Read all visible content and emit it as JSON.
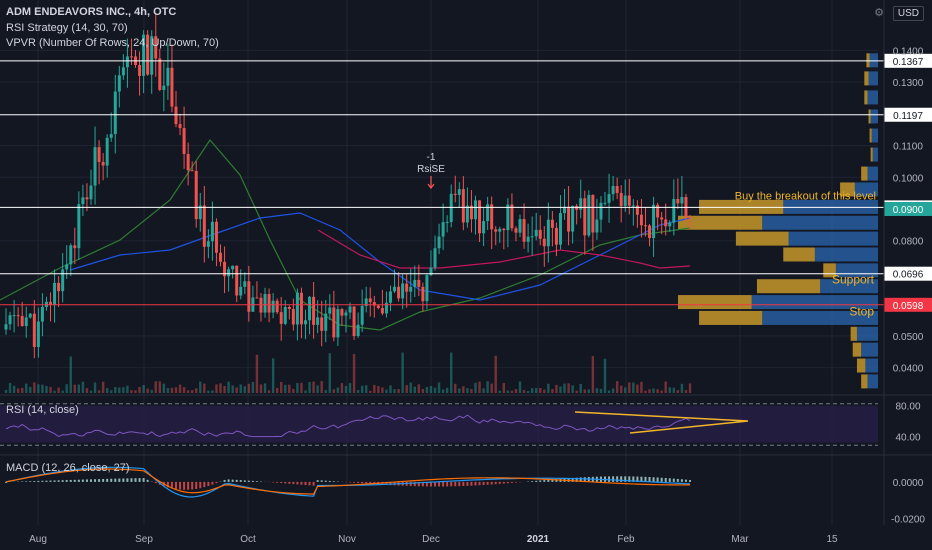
{
  "header": {
    "title": "ADM ENDEAVORS INC., 4h, OTC",
    "ind1": "RSI Strategy (14, 30, 70)",
    "ind2": "VPVR (Number Of Rows, 24, Up/Down, 70)",
    "rsi_label": "RSI (14, close)",
    "macd_label": "MACD (12, 26, close, 27)",
    "currency": "USD"
  },
  "colors": {
    "bg": "#131722",
    "grid": "#1f2433",
    "up": "#26a69a",
    "down": "#ef5350",
    "vpvr_up": "#2962a8",
    "vpvr_down": "#c7962a",
    "support_red": "#f23645",
    "ma_red": "#c2185b",
    "ma_green": "#2e7d32",
    "ma_blue": "#1e53e5",
    "annot": "#f0b429",
    "rsi_bg": "#2a1f4a"
  },
  "chart_data": {
    "type": "candlestick",
    "x_ticks": [
      "Aug",
      "Sep",
      "Oct",
      "Nov",
      "Dec",
      "2021",
      "Feb",
      "Mar",
      "15"
    ],
    "y_ticks": [
      "0.1400",
      "0.1300",
      "0.1100",
      "0.1000",
      "0.0800",
      "0.0500",
      "0.0400"
    ],
    "ylim": [
      0.032,
      0.142
    ],
    "price_levels": [
      {
        "value": 0.1367,
        "label": "0.1367",
        "color": "#ffffff"
      },
      {
        "value": 0.1197,
        "label": "0.1197",
        "color": "#ffffff"
      },
      {
        "value": 0.0905,
        "label": "0.0905",
        "color": "#ffffff"
      },
      {
        "value": 0.0696,
        "label": "0.0696",
        "color": "#ffffff"
      },
      {
        "value": 0.0598,
        "label": "0.0598",
        "color": "#f23645"
      }
    ],
    "last_price": {
      "value": 0.09,
      "label": "0.0900"
    },
    "annotations": [
      {
        "text": "Buy the breakout of this level",
        "y": 0.093
      },
      {
        "text": "Support",
        "y": 0.0665
      },
      {
        "text": "Stop",
        "y": 0.0565
      }
    ],
    "signal": {
      "top": "-1",
      "bottom": "RsiSE"
    },
    "trend": [
      0.052,
      0.058,
      0.05,
      0.062,
      0.075,
      0.09,
      0.105,
      0.12,
      0.133,
      0.138,
      0.136,
      0.128,
      0.1,
      0.082,
      0.078,
      0.07,
      0.062,
      0.058,
      0.056,
      0.058,
      0.06,
      0.056,
      0.054,
      0.055,
      0.057,
      0.06,
      0.062,
      0.064,
      0.067,
      0.09,
      0.09,
      0.088,
      0.086,
      0.085,
      0.085,
      0.083,
      0.084,
      0.085,
      0.088,
      0.09,
      0.092,
      0.089,
      0.087,
      0.087,
      0.088,
      0.089
    ],
    "vpvr": [
      {
        "price": 0.1367,
        "up": 8,
        "down": 3
      },
      {
        "price": 0.131,
        "up": 9,
        "down": 4
      },
      {
        "price": 0.125,
        "up": 10,
        "down": 3
      },
      {
        "price": 0.119,
        "up": 7,
        "down": 2
      },
      {
        "price": 0.113,
        "up": 6,
        "down": 2
      },
      {
        "price": 0.107,
        "up": 5,
        "down": 2
      },
      {
        "price": 0.101,
        "up": 10,
        "down": 6
      },
      {
        "price": 0.096,
        "up": 22,
        "down": 14
      },
      {
        "price": 0.0905,
        "up": 90,
        "down": 80
      },
      {
        "price": 0.0855,
        "up": 110,
        "down": 80
      },
      {
        "price": 0.0805,
        "up": 85,
        "down": 50
      },
      {
        "price": 0.0755,
        "up": 60,
        "down": 30
      },
      {
        "price": 0.0705,
        "up": 40,
        "down": 12
      },
      {
        "price": 0.0655,
        "up": 55,
        "down": 60
      },
      {
        "price": 0.0605,
        "up": 120,
        "down": 70
      },
      {
        "price": 0.0555,
        "up": 110,
        "down": 60
      },
      {
        "price": 0.0505,
        "up": 20,
        "down": 6
      },
      {
        "price": 0.0455,
        "up": 16,
        "down": 8
      },
      {
        "price": 0.0405,
        "up": 12,
        "down": 8
      },
      {
        "price": 0.0355,
        "up": 10,
        "down": 6
      }
    ],
    "rsi": {
      "y_ticks": [
        "80.00",
        "40.00"
      ],
      "ylim": [
        20,
        90
      ]
    },
    "macd": {
      "y_ticks": [
        "0.0000",
        "-0.0200"
      ],
      "ylim": [
        -0.022,
        0.012
      ]
    }
  }
}
